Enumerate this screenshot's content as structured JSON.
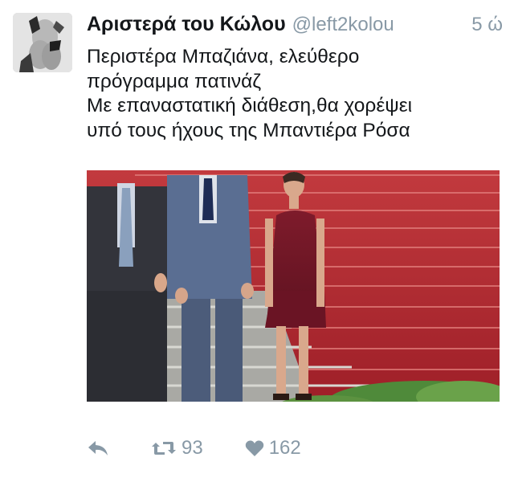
{
  "tweet": {
    "display_name": "Αριστερά του Κώλου",
    "handle": "@left2kolou",
    "timestamp": "5 ώ",
    "text_lines": [
      "Περιστέρα Μπαζιάνα, ελεύθερο",
      "πρόγραμμα πατινάζ",
      "Με επαναστατική διάθεση,θα χορέψει",
      "υπό τους ήχους της Μπαντιέρα Ρόσα"
    ],
    "retweet_count": "93",
    "like_count": "162"
  },
  "icons": {
    "reply": "reply-icon",
    "retweet": "retweet-icon",
    "like": "heart-icon"
  },
  "colors": {
    "text": "#14171a",
    "secondary": "#8899a6",
    "carpet": "#b3262f"
  }
}
